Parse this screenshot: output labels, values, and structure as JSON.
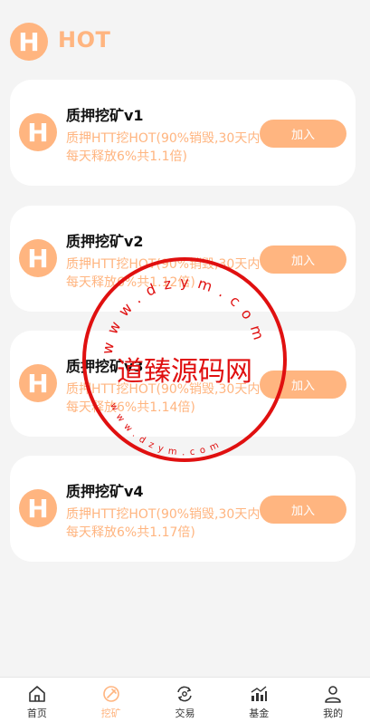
{
  "header": {
    "logo_letter": "H",
    "title": "HOT"
  },
  "cards": [
    {
      "title": "质押挖矿v1",
      "desc": "质押HTT挖HOT(90%销毁,30天内每天释放6%共1.1倍)",
      "button": "加入"
    },
    {
      "title": "质押挖矿v2",
      "desc": "质押HTT挖HOT(90%销毁,30天内每天释放6%共1.12倍)",
      "button": "加入"
    },
    {
      "title": "质押挖矿v3",
      "desc": "质押HTT挖HOT(90%销毁,30天内每天释放6%共1.14倍)",
      "button": "加入"
    },
    {
      "title": "质押挖矿v4",
      "desc": "质押HTT挖HOT(90%销毁,30天内每天释放6%共1.17倍)",
      "button": "加入"
    }
  ],
  "card_icon_letter": "H",
  "tabbar": [
    {
      "label": "首页",
      "icon": "home-icon"
    },
    {
      "label": "挖矿",
      "icon": "mining-icon"
    },
    {
      "label": "交易",
      "icon": "exchange-icon"
    },
    {
      "label": "基金",
      "icon": "fund-chart-icon"
    },
    {
      "label": "我的",
      "icon": "profile-icon"
    }
  ],
  "active_tab": "挖矿",
  "watermark": {
    "main": "道臻源码网",
    "ring_top": "www.dzym.com",
    "ring_bottom": "www.dzym.com"
  },
  "colors": {
    "accent": "#ffb580",
    "stamp": "#e01010",
    "background": "#f4f4f4"
  }
}
